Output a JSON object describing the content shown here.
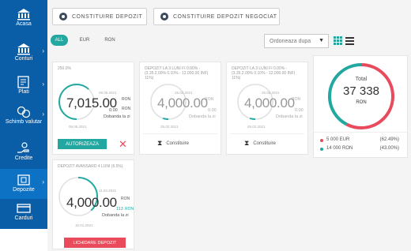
{
  "sidebar": {
    "items": [
      {
        "label": "Acasa"
      },
      {
        "label": "Conturi"
      },
      {
        "label": "Plati"
      },
      {
        "label": "Schimb valutar"
      },
      {
        "label": "Credite"
      },
      {
        "label": "Depozite"
      },
      {
        "label": "Carduri"
      }
    ]
  },
  "header": {
    "btn_constituie": "CONSTITUIRE DEPOZIT",
    "btn_negociat": "CONSTITUIRE DEPOZIT NEGOCIAT"
  },
  "filters": {
    "all": "ALL",
    "eur": "EUR",
    "ron": "RON"
  },
  "sort": {
    "label": "Ordoneaza dupa"
  },
  "cards": [
    {
      "title": "250.0%",
      "date_top": "09.05.2021",
      "amount": "7,015.00",
      "currency": "RON",
      "interest": "0.00",
      "interest_currency": "RON",
      "interest_label": "Dobanda la zi",
      "date_bottom": "09.05.2021",
      "action": "AUTORIZEAZA",
      "progress": 0.62
    },
    {
      "title": "DEPOZIT LA 3 LUNI FI 0.00% - (3.35.2.00% 0.10% - 12.000.00 INF) 11%)",
      "date_top": "25.02.2021",
      "amount": "4,000.00",
      "currency": "RON",
      "interest": "0.00",
      "interest_label": "Dobanda la zi",
      "date_bottom": "25.02.2021",
      "action": "Constituire",
      "progress": 0.05
    },
    {
      "title": "DEPOZIT LA 3 LUNI FI 0.00% - (3.35.2.00% 0.10% - 12.000.00 INF) 11%)",
      "date_top": "25.02.2021",
      "amount": "4,000.00",
      "currency": "RON",
      "interest": "0.00",
      "interest_label": "Dobanda la zi",
      "date_bottom": "25.02.2021",
      "action": "Constituire",
      "progress": 0.05
    },
    {
      "title": "DEPOZIT AVANSARD 4 LUNI (6.5%)",
      "date_top": "11.04.2021",
      "amount": "4,000.00",
      "currency": "RON",
      "interest": "113",
      "interest_currency": "RON",
      "interest_label": "Dobanda la zi",
      "date_bottom": "10.01.2021",
      "action": "LICHIDARE DEPOZIT",
      "progress": 0.38
    }
  ],
  "summary": {
    "total_label": "Total",
    "total_value": "37 338",
    "currency": "RON",
    "legend": [
      {
        "text": "5 000 EUR",
        "pct": "(62.49%)",
        "color": "#e94b5c",
        "fraction": 0.575
      },
      {
        "text": "14 000 RON",
        "pct": "(43.00%)",
        "color": "#22a8a0",
        "fraction": 0.425
      }
    ]
  },
  "colors": {
    "sidebar": "#0a5ea8",
    "accent_teal": "#22a8a0",
    "accent_red": "#e94b5c"
  }
}
